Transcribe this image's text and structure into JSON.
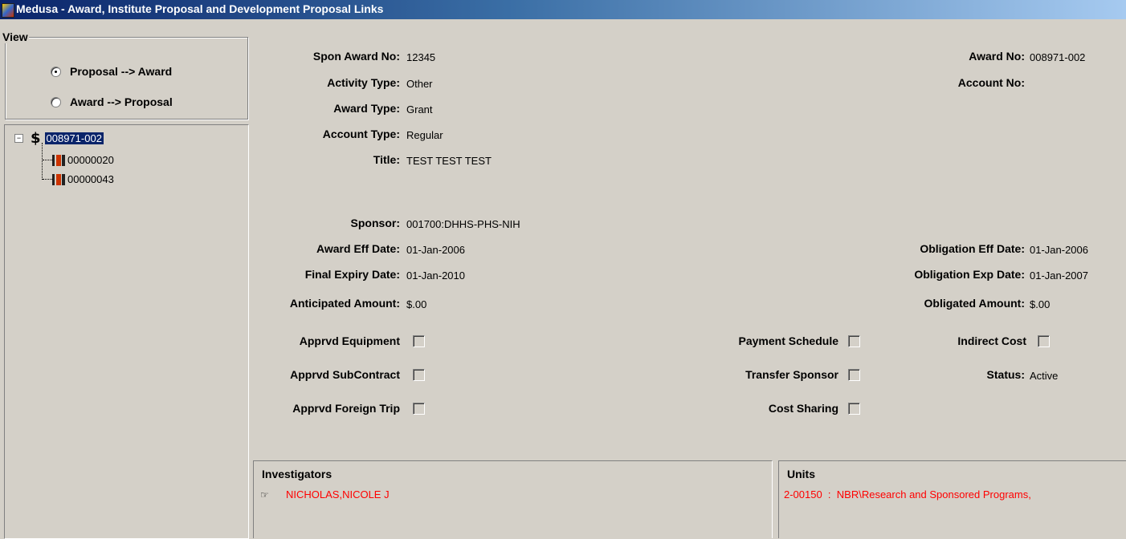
{
  "window": {
    "title": "Medusa - Award, Institute Proposal and Development Proposal Links"
  },
  "view": {
    "legend": "View",
    "options": [
      {
        "label": "Proposal --> Award",
        "checked": true
      },
      {
        "label": "Award --> Proposal",
        "checked": false
      }
    ]
  },
  "tree": {
    "root": "008971-002",
    "children": [
      "00000020",
      "00000043"
    ],
    "root_icon": "$"
  },
  "award": {
    "spon_award_no": {
      "label": "Spon Award No:",
      "value": "12345"
    },
    "activity_type": {
      "label": "Activity Type:",
      "value": "Other"
    },
    "award_type": {
      "label": "Award Type:",
      "value": "Grant"
    },
    "account_type": {
      "label": "Account Type:",
      "value": "Regular"
    },
    "title": {
      "label": "Title:",
      "value": "TEST TEST TEST"
    },
    "award_no": {
      "label": "Award No:",
      "value": "008971-002"
    },
    "account_no": {
      "label": "Account No:",
      "value": ""
    },
    "sponsor": {
      "label": "Sponsor:",
      "value": "001700:DHHS-PHS-NIH"
    },
    "award_eff_date": {
      "label": "Award Eff Date:",
      "value": "01-Jan-2006"
    },
    "final_expiry_date": {
      "label": "Final Expiry Date:",
      "value": "01-Jan-2010"
    },
    "anticipated_amount": {
      "label": "Anticipated Amount:",
      "value": "$.00"
    },
    "obligation_eff_date": {
      "label": "Obligation Eff Date:",
      "value": "01-Jan-2006"
    },
    "obligation_exp_date": {
      "label": "Obligation Exp Date:",
      "value": "01-Jan-2007"
    },
    "obligated_amount": {
      "label": "Obligated Amount:",
      "value": "$.00"
    },
    "status": {
      "label": "Status:",
      "value": "Active"
    }
  },
  "flags": {
    "apprvd_equipment": {
      "label": "Apprvd Equipment",
      "checked": false
    },
    "apprvd_subcontract": {
      "label": "Apprvd SubContract",
      "checked": false
    },
    "apprvd_foreign_trip": {
      "label": "Apprvd Foreign Trip",
      "checked": false
    },
    "payment_schedule": {
      "label": "Payment Schedule",
      "checked": false
    },
    "transfer_sponsor": {
      "label": "Transfer Sponsor",
      "checked": false
    },
    "cost_sharing": {
      "label": "Cost Sharing",
      "checked": false
    },
    "indirect_cost": {
      "label": "Indirect Cost",
      "checked": false
    }
  },
  "investigators": {
    "title": "Investigators",
    "items": [
      "NICHOLAS,NICOLE J"
    ]
  },
  "units": {
    "title": "Units",
    "items": [
      "2-00150  :  NBR\\Research and Sponsored Programs,"
    ]
  },
  "colors": {
    "selection": "#0a246a",
    "investigator_text": "#ff0000",
    "window_bg": "#d4d0c8"
  }
}
